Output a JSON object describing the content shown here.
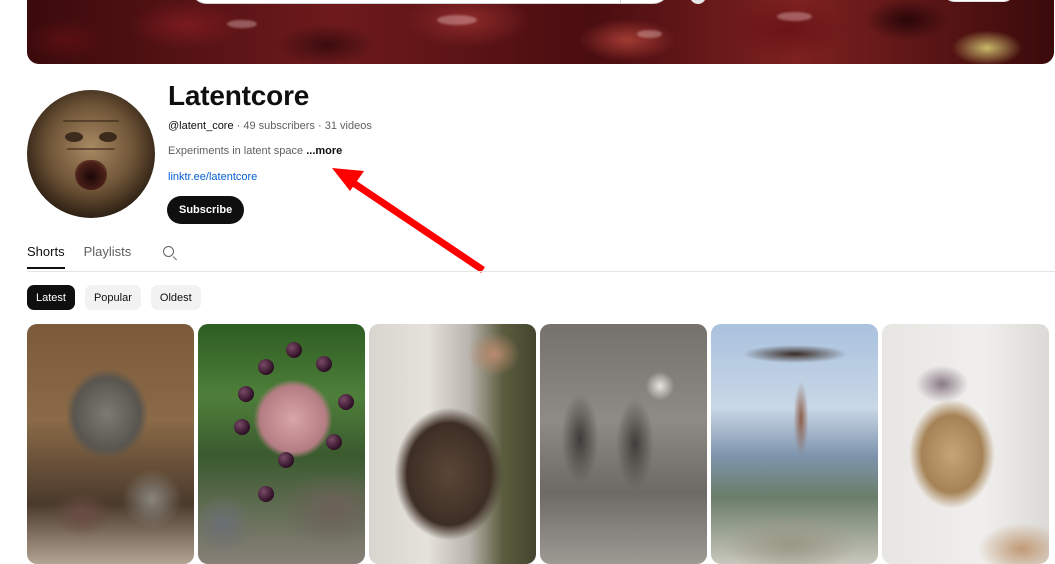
{
  "channel": {
    "name": "Latentcore",
    "handle": "@latent_core",
    "separator": "·",
    "subscribers": "49 subscribers",
    "videos": "31 videos",
    "description": "Experiments in latent space",
    "more_label": "...more",
    "link_text": "linktr.ee/latentcore",
    "subscribe_label": "Subscribe"
  },
  "tabs": [
    {
      "label": "Shorts",
      "active": true
    },
    {
      "label": "Playlists",
      "active": false
    }
  ],
  "filters": [
    {
      "label": "Latest",
      "selected": true
    },
    {
      "label": "Popular",
      "selected": false
    },
    {
      "label": "Oldest",
      "selected": false
    }
  ],
  "icons": {
    "tab_search": "search-icon"
  },
  "colors": {
    "annotation_arrow": "#ff0000",
    "link": "#065fd4",
    "primary": "#0f0f0f"
  },
  "shorts_count_visible": 6
}
